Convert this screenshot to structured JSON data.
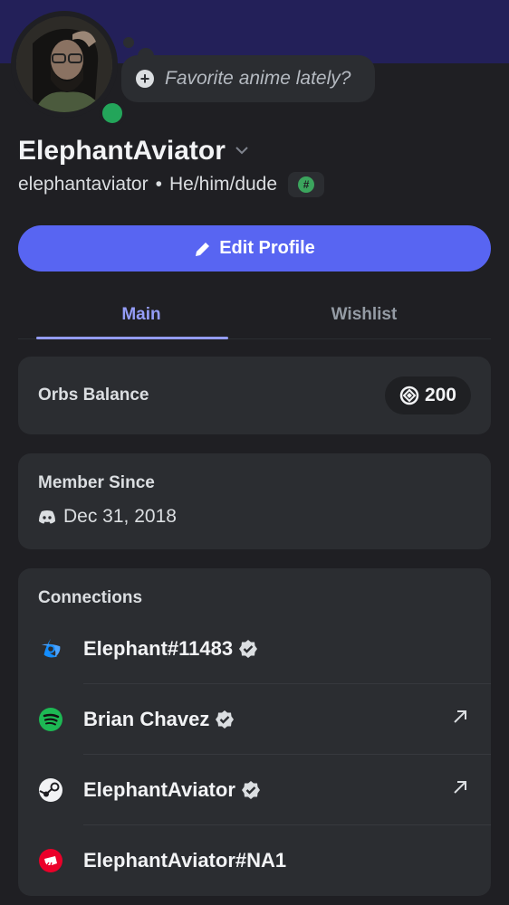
{
  "status_bubble": {
    "text": "Favorite anime lately?"
  },
  "profile": {
    "display_name": "ElephantAviator",
    "username": "elephantaviator",
    "separator": "•",
    "pronouns": "He/him/dude"
  },
  "actions": {
    "edit_profile_label": "Edit Profile"
  },
  "tabs": [
    {
      "label": "Main"
    },
    {
      "label": "Wishlist"
    }
  ],
  "orbs": {
    "label": "Orbs Balance",
    "value": "200"
  },
  "member_since": {
    "label": "Member Since",
    "date": "Dec 31, 2018"
  },
  "connections": {
    "label": "Connections",
    "items": [
      {
        "service": "battlenet-icon",
        "name": "Elephant#11483"
      },
      {
        "service": "spotify-icon",
        "name": "Brian Chavez"
      },
      {
        "service": "steam-icon",
        "name": "ElephantAviator"
      },
      {
        "service": "riot-icon",
        "name": "ElephantAviator#NA1"
      }
    ]
  },
  "colors": {
    "accent": "#5865f2",
    "online": "#23a55a",
    "card": "#2b2d31",
    "background": "#1f1f23",
    "banner": "#232059"
  }
}
